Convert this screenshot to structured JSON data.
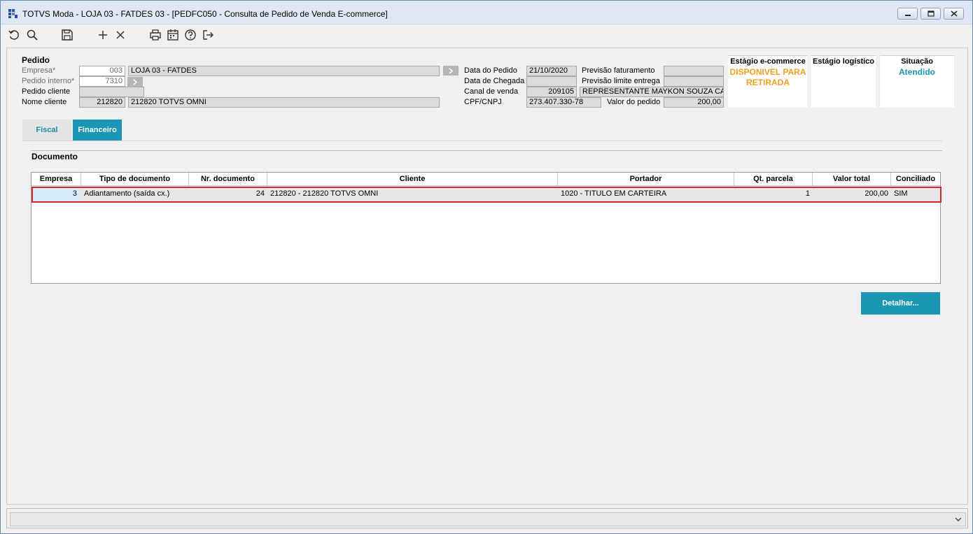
{
  "window": {
    "title": "TOTVS Moda - LOJA 03 - FATDES 03 - [PEDFC050 - Consulta de Pedido de Venda E-commerce]"
  },
  "toolbar": {
    "icons": [
      "refresh-icon",
      "search-icon",
      "save-icon",
      "add-icon",
      "close-icon",
      "print-icon",
      "calendar-icon",
      "help-icon",
      "exit-icon"
    ]
  },
  "pedido": {
    "section_label": "Pedido",
    "empresa_label": "Empresa*",
    "empresa_code": "003",
    "empresa_name": "LOJA 03 - FATDES",
    "pedido_interno_label": "Pedido interno*",
    "pedido_interno": "7310",
    "pedido_cliente_label": "Pedido cliente",
    "pedido_cliente": "",
    "nome_cliente_label": "Nome cliente",
    "nome_cliente_code": "212820",
    "nome_cliente_name": "212820   TOTVS OMNI",
    "data_pedido_label": "Data do Pedido",
    "data_pedido": "21/10/2020",
    "data_chegada_label": "Data de Chegada",
    "data_chegada": "",
    "canal_venda_label": "Canal de venda",
    "canal_venda_code": "209105",
    "canal_venda_name": "REPRESENTANTE MAYKON SOUZA CARDOSO",
    "cpf_label": "CPF/CNPJ",
    "cpf": "273.407.330-78",
    "prev_fat_label": "Previsão faturamento",
    "prev_fat": "",
    "prev_entrega_label": "Previsão limite entrega",
    "prev_entrega": "",
    "valor_label": "Valor do pedido",
    "valor": "200,00"
  },
  "stages": {
    "ecommerce_title": "Estágio e-commerce",
    "ecommerce_value": "DISPONIVEL PARA RETIRADA",
    "logistico_title": "Estágio logístico",
    "logistico_value": "",
    "situacao_title": "Situação",
    "situacao_value": "Atendido"
  },
  "tabs": [
    {
      "label": "Fiscal"
    },
    {
      "label": "Financeiro"
    }
  ],
  "documento": {
    "title": "Documento",
    "columns": [
      "Empresa",
      "Tipo de documento",
      "Nr. documento",
      "Cliente",
      "Portador",
      "Qt. parcela",
      "Valor total",
      "Conciliado"
    ],
    "rows": [
      {
        "empresa": "3",
        "tipo": "Adiantamento (saída cx.)",
        "nr": "24",
        "cliente": "212820 - 212820   TOTVS OMNI",
        "portador": "1020 - TITULO EM CARTEIRA",
        "qt_parcela": "1",
        "valor_total": "200,00",
        "conciliado": "SIM"
      }
    ]
  },
  "buttons": {
    "detalhar": "Detalhar..."
  },
  "colors": {
    "accent": "#1a95b4",
    "stage_orange": "#f0a020",
    "highlight_red": "#d4282e"
  }
}
